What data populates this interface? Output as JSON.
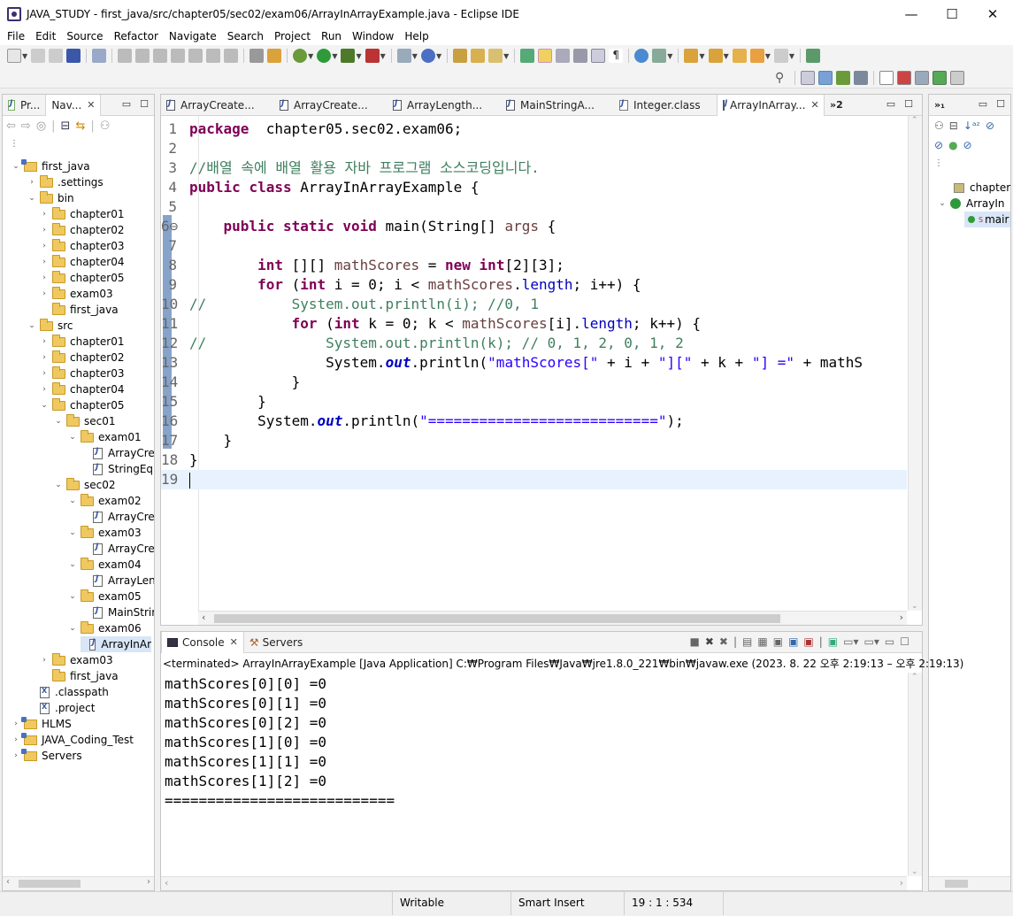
{
  "window": {
    "title": "JAVA_STUDY - first_java/src/chapter05/sec02/exam06/ArrayInArrayExample.java - Eclipse IDE",
    "minimize": "—",
    "maximize": "☐",
    "close": "✕"
  },
  "menu": [
    "File",
    "Edit",
    "Source",
    "Refactor",
    "Navigate",
    "Search",
    "Project",
    "Run",
    "Window",
    "Help"
  ],
  "left_panel": {
    "tabs": [
      {
        "label": "Pr..."
      },
      {
        "label": "Nav...",
        "close": "✕"
      }
    ],
    "tree": [
      {
        "label": "first_java",
        "type": "proj",
        "level": 0,
        "chev": "⌄"
      },
      {
        "label": ".settings",
        "type": "folder",
        "level": 1,
        "chev": "›"
      },
      {
        "label": "bin",
        "type": "folder",
        "level": 1,
        "chev": "⌄"
      },
      {
        "label": "chapter01",
        "type": "folder",
        "level": 2,
        "chev": "›"
      },
      {
        "label": "chapter02",
        "type": "folder",
        "level": 2,
        "chev": "›"
      },
      {
        "label": "chapter03",
        "type": "folder",
        "level": 2,
        "chev": "›"
      },
      {
        "label": "chapter04",
        "type": "folder",
        "level": 2,
        "chev": "›"
      },
      {
        "label": "chapter05",
        "type": "folder",
        "level": 2,
        "chev": "›"
      },
      {
        "label": "exam03",
        "type": "folder",
        "level": 2,
        "chev": "›"
      },
      {
        "label": "first_java",
        "type": "folder",
        "level": 2,
        "chev": ""
      },
      {
        "label": "src",
        "type": "folder",
        "level": 1,
        "chev": "⌄"
      },
      {
        "label": "chapter01",
        "type": "folder",
        "level": 2,
        "chev": "›"
      },
      {
        "label": "chapter02",
        "type": "folder",
        "level": 2,
        "chev": "›"
      },
      {
        "label": "chapter03",
        "type": "folder",
        "level": 2,
        "chev": "›"
      },
      {
        "label": "chapter04",
        "type": "folder",
        "level": 2,
        "chev": "›"
      },
      {
        "label": "chapter05",
        "type": "folder",
        "level": 2,
        "chev": "⌄"
      },
      {
        "label": "sec01",
        "type": "folder",
        "level": 3,
        "chev": "⌄"
      },
      {
        "label": "exam01",
        "type": "folder",
        "level": 4,
        "chev": "⌄"
      },
      {
        "label": "ArrayCrea",
        "type": "jfile",
        "level": 5,
        "chev": ""
      },
      {
        "label": "StringEqu",
        "type": "jfile",
        "level": 5,
        "chev": ""
      },
      {
        "label": "sec02",
        "type": "folder",
        "level": 3,
        "chev": "⌄"
      },
      {
        "label": "exam02",
        "type": "folder",
        "level": 4,
        "chev": "⌄"
      },
      {
        "label": "ArrayCrea",
        "type": "jfile",
        "level": 5,
        "chev": ""
      },
      {
        "label": "exam03",
        "type": "folder",
        "level": 4,
        "chev": "⌄"
      },
      {
        "label": "ArrayCrea",
        "type": "jfile",
        "level": 5,
        "chev": ""
      },
      {
        "label": "exam04",
        "type": "folder",
        "level": 4,
        "chev": "⌄"
      },
      {
        "label": "ArrayLeng",
        "type": "jfile",
        "level": 5,
        "chev": ""
      },
      {
        "label": "exam05",
        "type": "folder",
        "level": 4,
        "chev": "⌄"
      },
      {
        "label": "MainStrir",
        "type": "jfile",
        "level": 5,
        "chev": ""
      },
      {
        "label": "exam06",
        "type": "folder",
        "level": 4,
        "chev": "⌄"
      },
      {
        "label": "ArrayInAr",
        "type": "jfile",
        "level": 5,
        "chev": "",
        "selected": true
      },
      {
        "label": "exam03",
        "type": "folder",
        "level": 2,
        "chev": "›"
      },
      {
        "label": "first_java",
        "type": "folder",
        "level": 2,
        "chev": ""
      },
      {
        "label": ".classpath",
        "type": "xfile",
        "level": 1,
        "chev": ""
      },
      {
        "label": ".project",
        "type": "xfile",
        "level": 1,
        "chev": ""
      },
      {
        "label": "HLMS",
        "type": "proj",
        "level": 0,
        "chev": "›"
      },
      {
        "label": "JAVA_Coding_Test",
        "type": "proj",
        "level": 0,
        "chev": "›"
      },
      {
        "label": "Servers",
        "type": "proj",
        "level": 0,
        "chev": "›"
      }
    ]
  },
  "editor": {
    "tabs": [
      {
        "label": "ArrayCreate..."
      },
      {
        "label": "ArrayCreate..."
      },
      {
        "label": "ArrayLength..."
      },
      {
        "label": "MainStringA..."
      },
      {
        "label": "Integer.class"
      },
      {
        "label": "ArrayInArray...",
        "active": true,
        "close": "✕"
      }
    ],
    "overflow": "»2",
    "lines": [
      {
        "n": "1",
        "tokens": [
          [
            "kw",
            "package"
          ],
          [
            "",
            "  chapter05.sec02.exam06;"
          ]
        ]
      },
      {
        "n": "2",
        "tokens": []
      },
      {
        "n": "3",
        "tokens": [
          [
            "cm",
            "//배열 속에 배열 활용 자바 프로그램 소스코딩입니다."
          ]
        ]
      },
      {
        "n": "4",
        "tokens": [
          [
            "kw",
            "public"
          ],
          [
            "",
            " "
          ],
          [
            "kw",
            "class"
          ],
          [
            "",
            " ArrayInArrayExample {"
          ]
        ]
      },
      {
        "n": "5",
        "tokens": []
      },
      {
        "n": "6⊖",
        "tokens": [
          [
            "",
            "    "
          ],
          [
            "kw",
            "public"
          ],
          [
            "",
            " "
          ],
          [
            "kw",
            "static"
          ],
          [
            "",
            " "
          ],
          [
            "kw",
            "void"
          ],
          [
            "",
            " main(String[] "
          ],
          [
            "var",
            "args"
          ],
          [
            "",
            " {"
          ]
        ]
      },
      {
        "n": "7",
        "tokens": []
      },
      {
        "n": "8",
        "tokens": [
          [
            "",
            "        "
          ],
          [
            "kw",
            "int"
          ],
          [
            "",
            " [][] "
          ],
          [
            "var",
            "mathScores"
          ],
          [
            "",
            " = "
          ],
          [
            "kw",
            "new"
          ],
          [
            "",
            " "
          ],
          [
            "kw",
            "int"
          ],
          [
            "",
            "[2][3];"
          ]
        ]
      },
      {
        "n": "9",
        "tokens": [
          [
            "",
            "        "
          ],
          [
            "kw",
            "for"
          ],
          [
            "",
            " ("
          ],
          [
            "kw",
            "int"
          ],
          [
            "",
            " i = 0; i < "
          ],
          [
            "var",
            "mathScores"
          ],
          [
            "",
            "."
          ],
          [
            "fld",
            "length"
          ],
          [
            "",
            "; i++) {"
          ]
        ]
      },
      {
        "n": "10",
        "tokens": [
          [
            "cm",
            "//          System.out.println(i); //0, 1"
          ]
        ]
      },
      {
        "n": "11",
        "tokens": [
          [
            "",
            "            "
          ],
          [
            "kw",
            "for"
          ],
          [
            "",
            " ("
          ],
          [
            "kw",
            "int"
          ],
          [
            "",
            " k = 0; k < "
          ],
          [
            "var",
            "mathScores"
          ],
          [
            "",
            "[i]."
          ],
          [
            "fld",
            "length"
          ],
          [
            "",
            "; k++) {"
          ]
        ]
      },
      {
        "n": "12",
        "tokens": [
          [
            "cm",
            "//              System.out.println(k); // 0, 1, 2, 0, 1, 2"
          ]
        ]
      },
      {
        "n": "13",
        "tokens": [
          [
            "",
            "                System."
          ],
          [
            "sfld",
            "out"
          ],
          [
            "",
            ".println("
          ],
          [
            "st",
            "\"mathScores[\""
          ],
          [
            "",
            " + i + "
          ],
          [
            "st",
            "\"][\""
          ],
          [
            "",
            " + k + "
          ],
          [
            "st",
            "\"] =\""
          ],
          [
            "",
            " + mathS"
          ]
        ]
      },
      {
        "n": "14",
        "tokens": [
          [
            "",
            "            }"
          ]
        ]
      },
      {
        "n": "15",
        "tokens": [
          [
            "",
            "        }"
          ]
        ]
      },
      {
        "n": "16",
        "tokens": [
          [
            "",
            "        System."
          ],
          [
            "sfld",
            "out"
          ],
          [
            "",
            ".println("
          ],
          [
            "st",
            "\"===========================\""
          ],
          [
            "",
            ");"
          ]
        ]
      },
      {
        "n": "17",
        "tokens": [
          [
            "",
            "    }"
          ]
        ]
      },
      {
        "n": "18",
        "tokens": [
          [
            "",
            "}"
          ]
        ]
      },
      {
        "n": "19",
        "tokens": []
      }
    ]
  },
  "outline": {
    "items": [
      {
        "label": "chapter"
      },
      {
        "label": "ArrayIn"
      },
      {
        "label": "mair"
      }
    ]
  },
  "console": {
    "tabs": [
      {
        "label": "Console",
        "close": "✕"
      },
      {
        "label": "Servers"
      }
    ],
    "header": "<terminated> ArrayInArrayExample [Java Application] C:₩Program Files₩Java₩jre1.8.0_221₩bin₩javaw.exe  (2023. 8. 22 오후 2:19:13 – 오후 2:19:13)",
    "output": [
      "mathScores[0][0] =0",
      "mathScores[0][1] =0",
      "mathScores[0][2] =0",
      "mathScores[1][0] =0",
      "mathScores[1][1] =0",
      "mathScores[1][2] =0",
      "==========================="
    ]
  },
  "status": {
    "mode": "Writable",
    "insert": "Smart Insert",
    "position": "19 : 1 : 534"
  },
  "colors": {
    "keyword": "#7f0055",
    "comment": "#3f7f5f",
    "string": "#2a00ff",
    "field": "#0000c0",
    "variable": "#6a3e3e",
    "current_line": "#e8f2fe"
  }
}
